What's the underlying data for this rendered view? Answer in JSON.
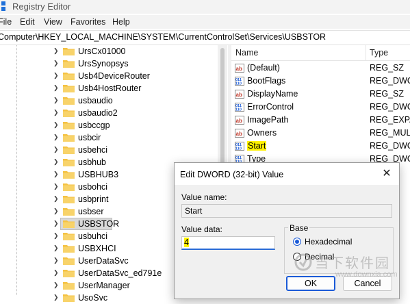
{
  "window": {
    "title": "Registry Editor"
  },
  "menu": [
    "File",
    "Edit",
    "View",
    "Favorites",
    "Help"
  ],
  "address": "Computer\\HKEY_LOCAL_MACHINE\\SYSTEM\\CurrentControlSet\\Services\\USBSTOR",
  "tree": {
    "items": [
      {
        "label": "UrsCx01000"
      },
      {
        "label": "UrsSynopsys"
      },
      {
        "label": "Usb4DeviceRouter"
      },
      {
        "label": "Usb4HostRouter"
      },
      {
        "label": "usbaudio"
      },
      {
        "label": "usbaudio2"
      },
      {
        "label": "usbccgp"
      },
      {
        "label": "usbcir"
      },
      {
        "label": "usbehci"
      },
      {
        "label": "usbhub"
      },
      {
        "label": "USBHUB3"
      },
      {
        "label": "usbohci"
      },
      {
        "label": "usbprint"
      },
      {
        "label": "usbser"
      },
      {
        "label": "USBSTOR",
        "selected": true
      },
      {
        "label": "usbuhci"
      },
      {
        "label": "USBXHCI"
      },
      {
        "label": "UserDataSvc"
      },
      {
        "label": "UserDataSvc_ed791e"
      },
      {
        "label": "UserManager"
      },
      {
        "label": "UsoSvc"
      }
    ]
  },
  "values": {
    "columns": {
      "name": "Name",
      "type": "Type"
    },
    "rows": [
      {
        "name": "(Default)",
        "type": "REG_SZ",
        "icon": "string-value-icon"
      },
      {
        "name": "BootFlags",
        "type": "REG_DWORD",
        "icon": "binary-value-icon"
      },
      {
        "name": "DisplayName",
        "type": "REG_SZ",
        "icon": "string-value-icon"
      },
      {
        "name": "ErrorControl",
        "type": "REG_DWORD",
        "icon": "binary-value-icon"
      },
      {
        "name": "ImagePath",
        "type": "REG_EXPAND_SZ",
        "icon": "string-value-icon"
      },
      {
        "name": "Owners",
        "type": "REG_MULTI_SZ",
        "icon": "string-value-icon"
      },
      {
        "name": "Start",
        "type": "REG_DWORD",
        "icon": "binary-value-icon",
        "highlighted": true
      },
      {
        "name": "Type",
        "type": "REG_DWORD",
        "icon": "binary-value-icon"
      }
    ]
  },
  "dialog": {
    "title": "Edit DWORD (32-bit) Value",
    "value_name_label": "Value name:",
    "value_name": "Start",
    "value_data_label": "Value data:",
    "value_data": "4",
    "base_label": "Base",
    "base_options": [
      {
        "label": "Hexadecimal",
        "checked": true
      },
      {
        "label": "Decimal",
        "checked": false
      }
    ],
    "ok_label": "OK",
    "cancel_label": "Cancel"
  },
  "watermark": {
    "text": "当下软件园",
    "url": "www.downxia.com"
  },
  "colors": {
    "highlight": "#fff200",
    "accent": "#1a5ad7",
    "folder": "#f5c242"
  }
}
